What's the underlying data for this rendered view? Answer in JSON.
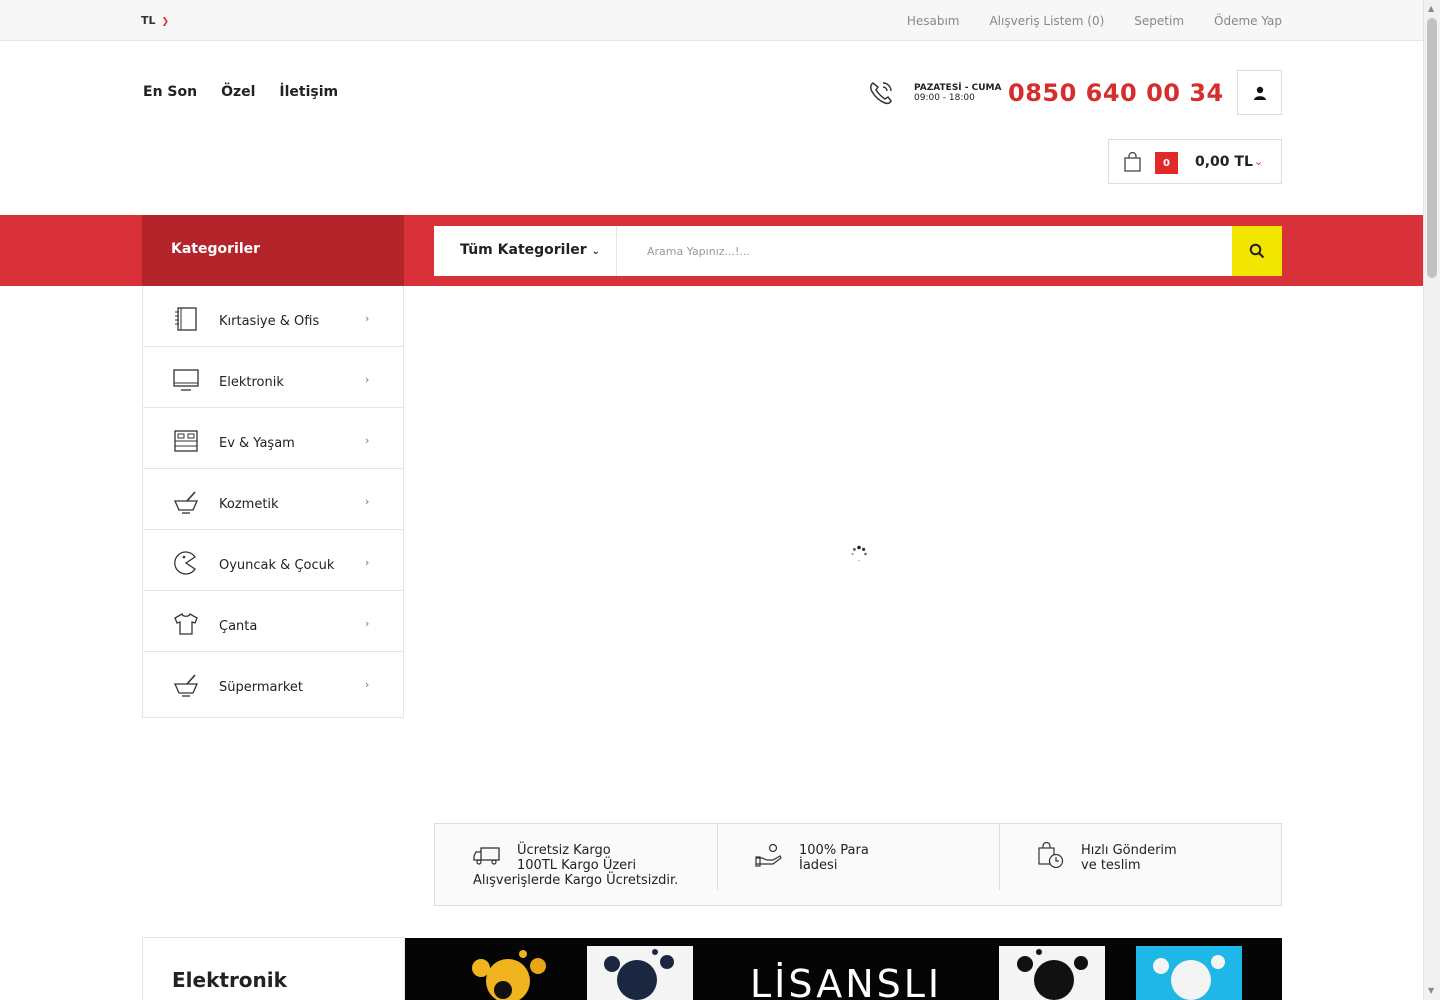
{
  "topbar": {
    "currency": "TL",
    "links": [
      "Hesabım",
      "Alışveriş Listem (0)",
      "Sepetim",
      "Ödeme Yap"
    ]
  },
  "nav": [
    "En Son",
    "Özel",
    "İletişim"
  ],
  "contact": {
    "days": "PAZATESİ - CUMA",
    "hours": "09:00 - 18:00",
    "phone": "0850 640 00 34"
  },
  "cart": {
    "count": "0",
    "total": "0,00 TL"
  },
  "categories_header": "Kategoriler",
  "search": {
    "category": "Tüm Kategoriler",
    "placeholder": "Arama Yapınız...!..."
  },
  "categories": [
    {
      "label": "Kırtasiye & Ofis",
      "icon": "notebook-icon"
    },
    {
      "label": "Elektronik",
      "icon": "monitor-icon"
    },
    {
      "label": "Ev & Yaşam",
      "icon": "bed-icon"
    },
    {
      "label": "Kozmetik",
      "icon": "mortar-icon"
    },
    {
      "label": "Oyuncak & Çocuk",
      "icon": "pacman-icon"
    },
    {
      "label": "Çanta",
      "icon": "tshirt-icon"
    },
    {
      "label": "Süpermarket",
      "icon": "mortar-icon"
    }
  ],
  "features": [
    {
      "line1": "Ücretsiz Kargo",
      "line2": "100TL Kargo Üzeri",
      "line3": "Alışverişlerde Kargo Ücretsizdir.",
      "icon": "truck-icon"
    },
    {
      "line1": "100% Para",
      "line2": "İadesi",
      "icon": "hand-money-icon"
    },
    {
      "line1": "Hızlı Gönderim",
      "line2": "ve teslim",
      "icon": "bag-clock-icon"
    }
  ],
  "section_title": "Elektronik",
  "banner_text": "LİSANSLI",
  "colors": {
    "accent_red": "#d8313a",
    "dark_red": "#b4242b",
    "search_yellow": "#f2e600",
    "phone_red": "#d62d2d"
  }
}
